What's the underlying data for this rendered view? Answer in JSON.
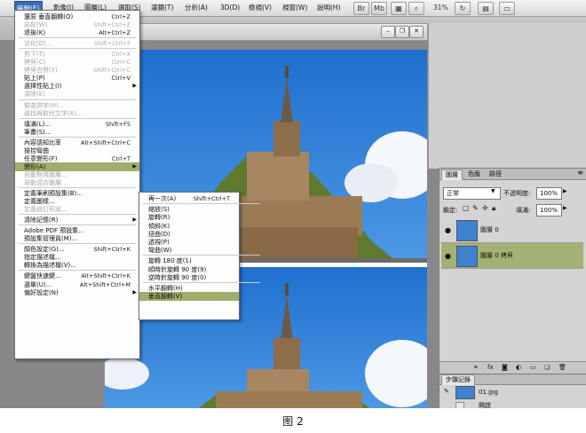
{
  "menubar": {
    "items": [
      "編輯(E)",
      "影像(I)",
      "圖層(L)",
      "選取(S)",
      "濾鏡(T)",
      "分析(A)",
      "3D(D)",
      "檢視(V)",
      "視窗(W)",
      "說明(H)"
    ],
    "zoom": "31%"
  },
  "edit_menu": {
    "items": [
      {
        "label": "還原 垂直翻轉(O)",
        "shortcut": "Ctrl+Z",
        "enabled": true
      },
      {
        "label": "向前(W)",
        "shortcut": "Shift+Ctrl+Z",
        "enabled": false
      },
      {
        "label": "退後(K)",
        "shortcut": "Alt+Ctrl+Z",
        "enabled": true
      },
      {
        "sep": true
      },
      {
        "label": "淡化(D)...",
        "shortcut": "Shift+Ctrl+F",
        "enabled": false
      },
      {
        "sep": true
      },
      {
        "label": "剪下(T)",
        "shortcut": "Ctrl+X",
        "enabled": false
      },
      {
        "label": "拷貝(C)",
        "shortcut": "Ctrl+C",
        "enabled": false
      },
      {
        "label": "拷貝合併(Y)",
        "shortcut": "Shift+Ctrl+C",
        "enabled": false
      },
      {
        "label": "貼上(P)",
        "shortcut": "Ctrl+V",
        "enabled": true
      },
      {
        "label": "選擇性貼上(I)",
        "shortcut": "",
        "enabled": true,
        "submenu": true
      },
      {
        "label": "清除(E)",
        "shortcut": "",
        "enabled": false
      },
      {
        "sep": true
      },
      {
        "label": "檢查拼字(H)...",
        "shortcut": "",
        "enabled": false
      },
      {
        "label": "尋找與取代文字(X)...",
        "shortcut": "",
        "enabled": false
      },
      {
        "sep": true
      },
      {
        "label": "填滿(L)...",
        "shortcut": "Shift+F5",
        "enabled": true
      },
      {
        "label": "筆畫(S)...",
        "shortcut": "",
        "enabled": true
      },
      {
        "sep": true
      },
      {
        "label": "內容感知比率",
        "shortcut": "Alt+Shift+Ctrl+C",
        "enabled": true
      },
      {
        "label": "操控彎曲",
        "shortcut": "",
        "enabled": true
      },
      {
        "label": "任意變形(F)",
        "shortcut": "Ctrl+T",
        "enabled": true
      },
      {
        "label": "變形(A)",
        "shortcut": "",
        "enabled": true,
        "submenu": true,
        "highlighted": true
      },
      {
        "label": "自動對齊圖層...",
        "shortcut": "",
        "enabled": false
      },
      {
        "label": "自動混合圖層...",
        "shortcut": "",
        "enabled": false
      },
      {
        "sep": true
      },
      {
        "label": "定義筆刷預設集(B)...",
        "shortcut": "",
        "enabled": true
      },
      {
        "label": "定義圖樣...",
        "shortcut": "",
        "enabled": true
      },
      {
        "label": "定義自訂形狀...",
        "shortcut": "",
        "enabled": false
      },
      {
        "sep": true
      },
      {
        "label": "清除記憶(R)",
        "shortcut": "",
        "enabled": true,
        "submenu": true
      },
      {
        "sep": true
      },
      {
        "label": "Adobe PDF 預設集...",
        "shortcut": "",
        "enabled": true
      },
      {
        "label": "預設集管理員(M)...",
        "shortcut": "",
        "enabled": true
      },
      {
        "sep": true
      },
      {
        "label": "顏色設定(G)...",
        "shortcut": "Shift+Ctrl+K",
        "enabled": true
      },
      {
        "label": "指定描述檔...",
        "shortcut": "",
        "enabled": true
      },
      {
        "label": "轉換為描述檔(V)...",
        "shortcut": "",
        "enabled": true
      },
      {
        "sep": true
      },
      {
        "label": "鍵盤快速鍵...",
        "shortcut": "Alt+Shift+Ctrl+K",
        "enabled": true
      },
      {
        "label": "選單(U)...",
        "shortcut": "Alt+Shift+Ctrl+M",
        "enabled": true
      },
      {
        "label": "偏好設定(N)",
        "shortcut": "",
        "enabled": true,
        "submenu": true
      }
    ]
  },
  "transform_submenu": {
    "items": [
      {
        "label": "再一次(A)",
        "shortcut": "Shift+Ctrl+T"
      },
      {
        "sep": true
      },
      {
        "label": "縮放(S)"
      },
      {
        "label": "旋轉(R)"
      },
      {
        "label": "傾斜(K)"
      },
      {
        "label": "扭曲(D)"
      },
      {
        "label": "透視(P)"
      },
      {
        "label": "彎曲(W)"
      },
      {
        "sep": true
      },
      {
        "label": "旋轉 180 度(1)"
      },
      {
        "label": "順時針旋轉 90 度(9)"
      },
      {
        "label": "逆時針旋轉 90 度(0)"
      },
      {
        "sep": true
      },
      {
        "label": "水平翻轉(H)"
      },
      {
        "label": "垂直翻轉(V)",
        "highlighted": true
      }
    ]
  },
  "layers_panel": {
    "tabs": [
      "圖層",
      "色版",
      "路徑"
    ],
    "blend_mode": "正常",
    "opacity_label": "不透明度:",
    "opacity": "100%",
    "lock_label": "鎖定:",
    "fill_label": "填滿:",
    "fill": "100%",
    "layers": [
      {
        "name": "圖層 0",
        "selected": false
      },
      {
        "name": "圖層 0 拷貝",
        "selected": true
      }
    ]
  },
  "history_panel": {
    "title": "步驟記錄",
    "items": [
      "01.jpg",
      "開啟"
    ]
  },
  "caption": "图 2"
}
